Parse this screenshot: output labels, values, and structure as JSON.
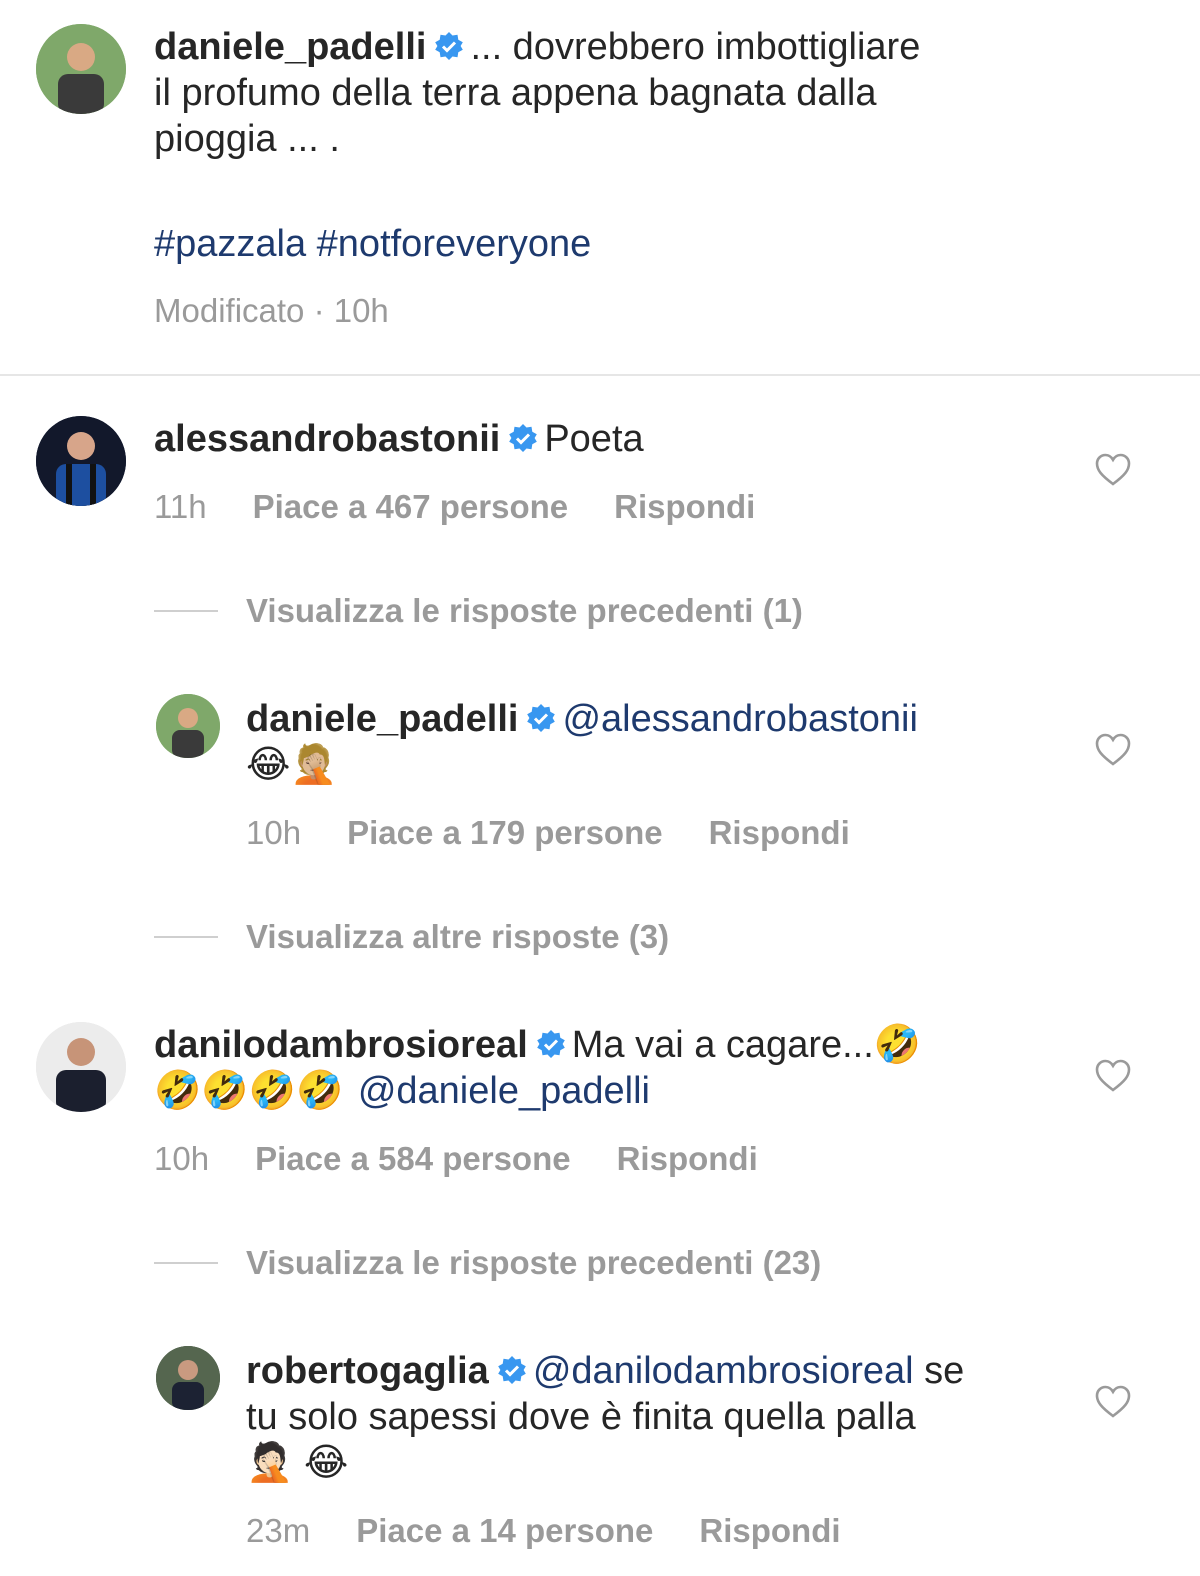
{
  "caption": {
    "username": "daniele_padelli",
    "text_line1": "... dovrebbero imbottigliare",
    "text_line2": "il profumo della terra appena bagnata dalla",
    "text_line3": "pioggia ... .",
    "hashtags": "#pazzala #notforeveryone",
    "meta": "Modificato · 10h"
  },
  "comments": [
    {
      "username": "alessandrobastonii",
      "text": "Poeta",
      "time": "11h",
      "likes": "Piace a 467 persone",
      "reply": "Rispondi"
    },
    {
      "username": "daniele_padelli",
      "mention": "@alessandrobastonii",
      "emojis": "😂🤦🏼",
      "time": "10h",
      "likes": "Piace a 179 persone",
      "reply": "Rispondi"
    },
    {
      "username": "danilodambrosioreal",
      "text": "Ma vai a cagare...🤣",
      "line2_emojis": "🤣🤣🤣🤣",
      "mention": "@daniele_padelli",
      "time": "10h",
      "likes": "Piace a 584 persone",
      "reply": "Rispondi"
    },
    {
      "username": "robertogaglia",
      "mention": "@danilodambrosioreal",
      "text_line1_end": "se",
      "text_line2": "tu solo sapessi dove è finita quella palla",
      "emojis": "🤦🏻 😂",
      "time": "23m",
      "likes": "Piace a 14 persone",
      "reply": "Rispondi"
    }
  ],
  "toggles": {
    "prev_replies_1": "Visualizza le risposte precedenti (1)",
    "more_replies_3": "Visualizza altre risposte (3)",
    "prev_replies_23": "Visualizza le risposte precedenti (23)"
  },
  "colors": {
    "verified": "#3897f0",
    "link": "#1e3a6e",
    "meta": "#9a9a9a"
  },
  "icons": {
    "verified": "verified-badge-icon",
    "like": "heart-outline-icon"
  }
}
